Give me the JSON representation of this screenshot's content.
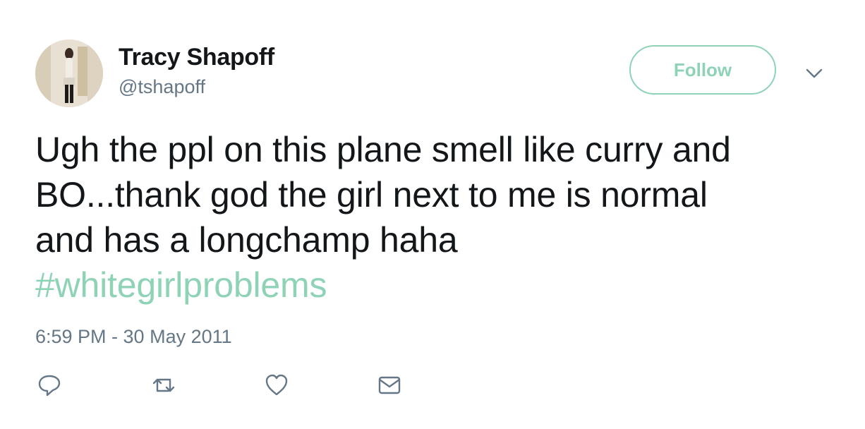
{
  "user": {
    "display_name": "Tracy Shapoff",
    "handle": "@tshapoff"
  },
  "follow_label": "Follow",
  "tweet": {
    "lines": [
      "Ugh the ppl on this plane smell like curry and",
      "BO...thank god the girl next to me is normal",
      "and has a longchamp haha"
    ],
    "hashtag": "#whitegirlproblems",
    "timestamp": "6:59 PM - 30 May 2011"
  },
  "actions": [
    "reply-icon",
    "retweet-icon",
    "like-icon",
    "message-icon"
  ],
  "colors": {
    "accent": "#8fd3b6",
    "text": "#14171a",
    "secondary": "#657786"
  }
}
